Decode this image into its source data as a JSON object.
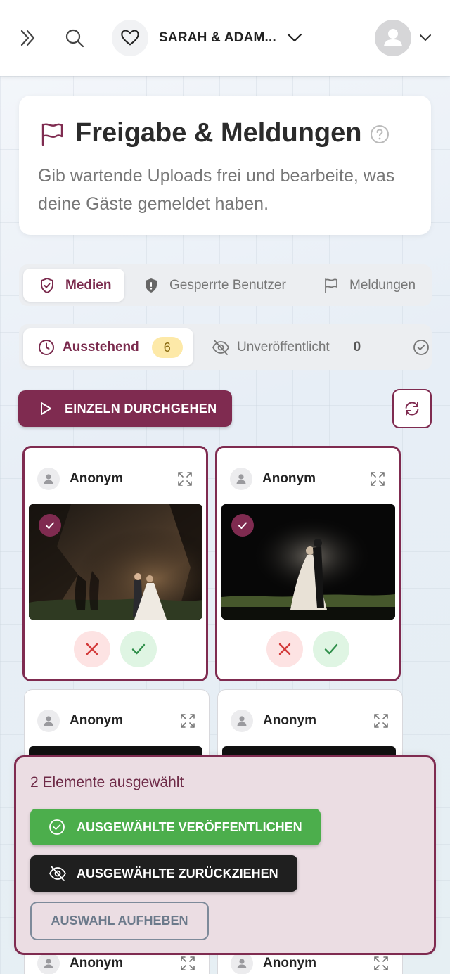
{
  "header": {
    "event_name": "SARAH & ADAM...",
    "icons": [
      "expand-icon",
      "search-icon",
      "heart-icon",
      "chevron-down-icon",
      "avatar",
      "chevron-down-icon"
    ]
  },
  "title_card": {
    "title": "Freigabe & Meldungen",
    "subtitle": "Gib wartende Uploads frei und bearbeite, was deine Gäste gemeldet haben."
  },
  "main_tabs": [
    {
      "label": "Medien",
      "icon": "shield-check-icon",
      "active": true
    },
    {
      "label": "Gesperrte Benutzer",
      "icon": "shield-icon",
      "active": false
    },
    {
      "label": "Meldungen",
      "icon": "flag-icon",
      "active": false
    }
  ],
  "status_tabs": [
    {
      "label": "Ausstehend",
      "count": "6",
      "icon": "clock-icon",
      "active": true
    },
    {
      "label": "Unveröffentlicht",
      "count": "0",
      "icon": "eye-off-icon",
      "active": false
    }
  ],
  "actions": {
    "walk_through": "EINZELN DURCHGEHEN"
  },
  "cards": [
    {
      "user": "Anonym",
      "selected": true
    },
    {
      "user": "Anonym",
      "selected": true
    },
    {
      "user": "Anonym",
      "selected": false
    },
    {
      "user": "Anonym",
      "selected": false
    },
    {
      "user": "Anonym",
      "selected": false
    },
    {
      "user": "Anonym",
      "selected": false
    }
  ],
  "selection_panel": {
    "title": "2 Elemente ausgewählt",
    "publish": "AUSGEWÄHLTE VERÖFFENTLICHEN",
    "withdraw": "AUSGEWÄHLTE ZURÜCKZIEHEN",
    "clear": "AUSWAHL AUFHEBEN"
  },
  "colors": {
    "brand": "#7f2b50",
    "approve": "#4cae4c",
    "reject": "#d33a3a",
    "badge": "#fde9a8"
  }
}
